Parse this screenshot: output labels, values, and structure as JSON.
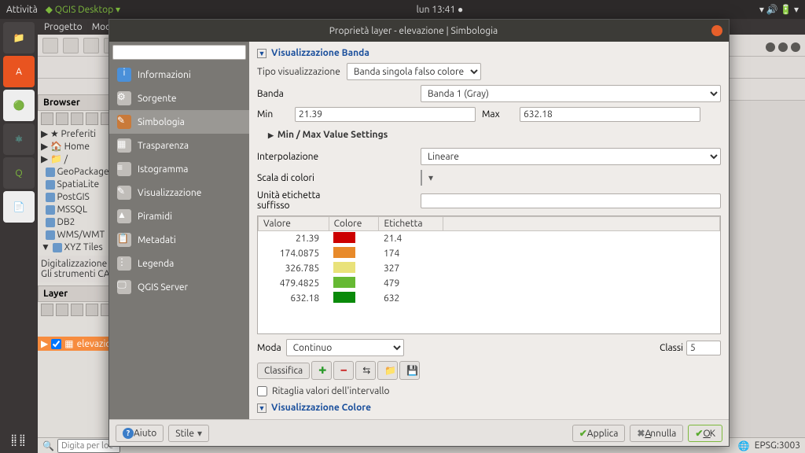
{
  "topbar": {
    "activities": "Attività",
    "app": "QGIS Desktop",
    "clock": "lun 13:41"
  },
  "menu": {
    "project": "Progetto",
    "edit": "Modi"
  },
  "browser": {
    "title": "Browser",
    "items": [
      "Preferiti",
      "Home",
      "/",
      "GeoPackage",
      "SpatiaLite",
      "PostGIS",
      "MSSQL",
      "DB2",
      "WMS/WMT",
      "XYZ Tiles"
    ]
  },
  "digital": {
    "l1": "Digitalizzazione a",
    "l2": "Gli strumenti CAD"
  },
  "layer": {
    "title": "Layer",
    "item": "elevazio"
  },
  "status": {
    "search": "Digita per loc",
    "epsg": "EPSG:3003"
  },
  "dialog": {
    "title": "Proprietà layer - elevazione | Simbologia",
    "side": [
      "Informazioni",
      "Sorgente",
      "Simbologia",
      "Trasparenza",
      "Istogramma",
      "Visualizzazione",
      "Piramidi",
      "Metadati",
      "Legenda",
      "QGIS Server"
    ],
    "band_section": "Visualizzazione Banda",
    "render_type_label": "Tipo visualizzazione",
    "render_type": "Banda singola falso colore",
    "band_label": "Banda",
    "band": "Banda 1 (Gray)",
    "min_label": "Min",
    "min": "21.39",
    "max_label": "Max",
    "max": "632.18",
    "minmax_settings": "Min / Max Value Settings",
    "interp_label": "Interpolazione",
    "interp": "Lineare",
    "ramp_label": "Scala di colori",
    "unit_label1": "Unità etichetta",
    "unit_label2": "suffisso",
    "unit": "",
    "table": {
      "cols": [
        "Valore",
        "Colore",
        "Etichetta"
      ],
      "rows": [
        {
          "v": "21.39",
          "c": "#cc0000",
          "e": "21.4"
        },
        {
          "v": "174.0875",
          "c": "#e88a2a",
          "e": "174"
        },
        {
          "v": "326.785",
          "c": "#e9e27a",
          "e": "327"
        },
        {
          "v": "479.4825",
          "c": "#66b933",
          "e": "479"
        },
        {
          "v": "632.18",
          "c": "#0a8a0a",
          "e": "632"
        }
      ]
    },
    "mode_label": "Moda",
    "mode": "Continuo",
    "classes_label": "Classi",
    "classes": "5",
    "classify": "Classifica",
    "clip": "Ritaglia valori dell'intervallo",
    "color_section": "Visualizzazione Colore",
    "help": "Aiuto",
    "style": "Stile",
    "apply": "Applica",
    "cancel": "Annulla",
    "ok": "OK"
  }
}
